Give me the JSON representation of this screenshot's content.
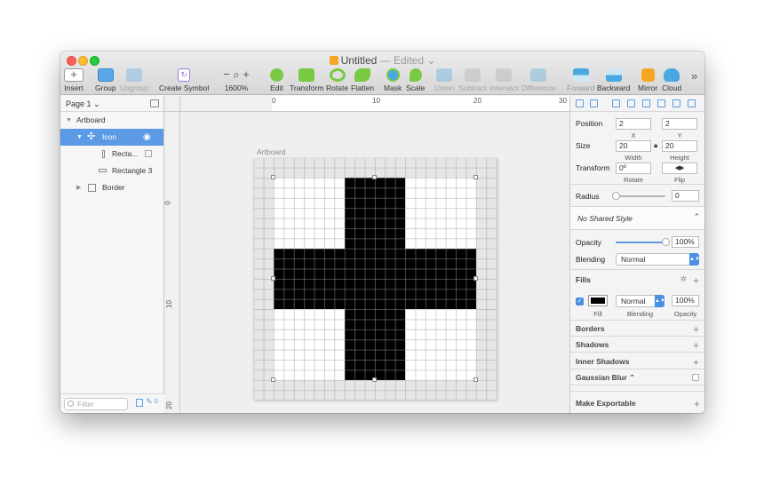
{
  "window": {
    "title": "Untitled",
    "title_suffix": "— Edited ⌄",
    "colors": {
      "accent": "#5c9ae6",
      "traffic_red": "#fc5f57",
      "traffic_yellow": "#fdbc2e",
      "traffic_green": "#28c840"
    }
  },
  "toolbar": {
    "items": [
      {
        "label": "Insert",
        "icon": "plus-icon"
      },
      {
        "label": "Group",
        "icon": "group-icon"
      },
      {
        "label": "Ungroup",
        "icon": "ungroup-icon"
      },
      {
        "label": "Create Symbol",
        "icon": "symbol-icon"
      },
      {
        "label": "1600%",
        "icon": "zoom-icon"
      },
      {
        "label": "Edit",
        "icon": "edit-icon"
      },
      {
        "label": "Transform",
        "icon": "transform-icon"
      },
      {
        "label": "Rotate",
        "icon": "rotate-icon"
      },
      {
        "label": "Flatten",
        "icon": "flatten-icon"
      },
      {
        "label": "Mask",
        "icon": "mask-icon"
      },
      {
        "label": "Scale",
        "icon": "scale-icon"
      },
      {
        "label": "Union",
        "icon": "union-icon"
      },
      {
        "label": "Subtract",
        "icon": "subtract-icon"
      },
      {
        "label": "Intersect",
        "icon": "intersect-icon"
      },
      {
        "label": "Difference",
        "icon": "difference-icon"
      },
      {
        "label": "Forward",
        "icon": "forward-icon"
      },
      {
        "label": "Backward",
        "icon": "backward-icon"
      },
      {
        "label": "Mirror",
        "icon": "mirror-icon"
      },
      {
        "label": "Cloud",
        "icon": "cloud-icon"
      }
    ],
    "overflow": "»",
    "zoom_minus": "−",
    "zoom_plus": "+"
  },
  "layers": {
    "page": "Page 1 ⌄",
    "items": [
      {
        "label": "Artboard"
      },
      {
        "label": "Icon"
      },
      {
        "label": "Recta..."
      },
      {
        "label": "Rectangle 3"
      },
      {
        "label": "Border"
      }
    ],
    "filter_placeholder": "Filter",
    "filter_count": "0"
  },
  "rulers": {
    "h": [
      "0",
      "10",
      "20",
      "30"
    ],
    "v": [
      "0",
      "10",
      "20"
    ]
  },
  "canvas": {
    "artboard_label": "Artboard"
  },
  "inspector": {
    "position": {
      "label": "Position",
      "x": "2",
      "y": "2",
      "x_label": "X",
      "y_label": "Y"
    },
    "size": {
      "label": "Size",
      "w": "20",
      "h": "20",
      "w_label": "Width",
      "h_label": "Height"
    },
    "transform": {
      "label": "Transform",
      "rotate": "0º",
      "rotate_label": "Rotate",
      "flip_label": "Flip"
    },
    "radius": {
      "label": "Radius",
      "value": "0",
      "level": 0
    },
    "shared_style": "No Shared Style",
    "opacity": {
      "label": "Opacity",
      "value": "100%",
      "level": 1.0
    },
    "blending": {
      "label": "Blending",
      "value": "Normal"
    },
    "fills": {
      "label": "Fills",
      "blend": "Normal",
      "opacity": "100%",
      "col_fill": "Fill",
      "col_blend": "Blending",
      "col_opacity": "Opacity",
      "color": "#000000"
    },
    "sections": [
      "Borders",
      "Shadows",
      "Inner Shadows",
      "Gaussian Blur ⌃"
    ],
    "export": "Make Exportable"
  }
}
